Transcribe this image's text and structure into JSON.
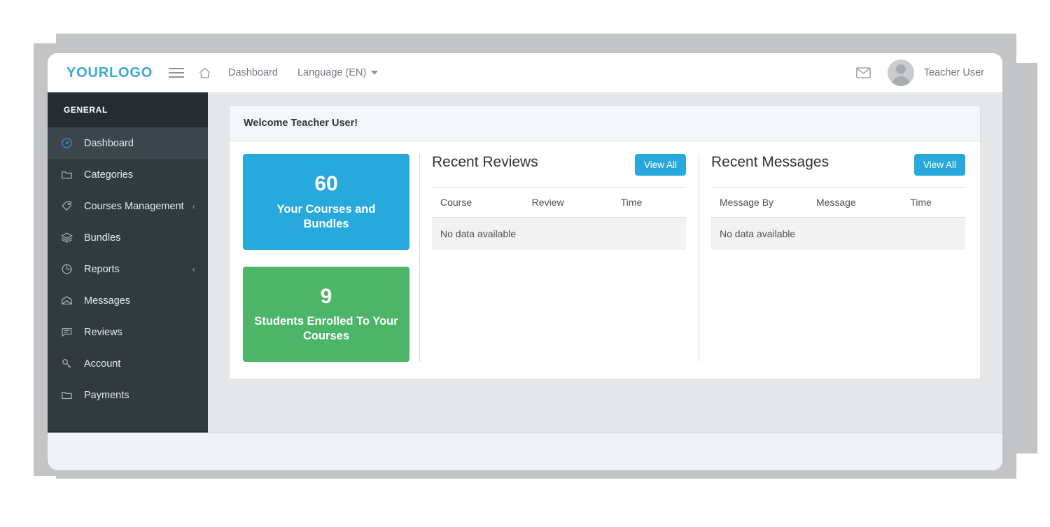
{
  "navbar": {
    "brand": "YOURLOGO",
    "menu_icon": "hamburger-icon",
    "home_icon": "home-icon",
    "dashboard_link": "Dashboard",
    "language_link": "Language (EN)",
    "mail_icon": "envelope-icon",
    "avatar_icon": "user-avatar",
    "user_name": "Teacher User"
  },
  "sidebar": {
    "heading": "GENERAL",
    "collapse_icon": "chevron-left-icon",
    "items": [
      {
        "label": "Dashboard",
        "icon": "speedometer-icon",
        "active": true,
        "arrow": ""
      },
      {
        "label": "Categories",
        "icon": "folder-icon",
        "active": false,
        "arrow": ""
      },
      {
        "label": "Courses Management",
        "icon": "tag-icon",
        "active": false,
        "arrow": "‹"
      },
      {
        "label": "Bundles",
        "icon": "layers-icon",
        "active": false,
        "arrow": ""
      },
      {
        "label": "Reports",
        "icon": "pie-chart-icon",
        "active": false,
        "arrow": "‹"
      },
      {
        "label": "Messages",
        "icon": "open-envelope-icon",
        "active": false,
        "arrow": ""
      },
      {
        "label": "Reviews",
        "icon": "comment-icon",
        "active": false,
        "arrow": ""
      },
      {
        "label": "Account",
        "icon": "key-icon",
        "active": false,
        "arrow": ""
      },
      {
        "label": "Payments",
        "icon": "wallet-icon",
        "active": false,
        "arrow": ""
      }
    ]
  },
  "main": {
    "welcome": "Welcome Teacher User!",
    "stats": [
      {
        "value": "60",
        "label": "Your Courses and Bundles",
        "color": "#28a9dd"
      },
      {
        "value": "9",
        "label": "Students Enrolled To Your Courses",
        "color": "#4cb568"
      }
    ],
    "reviews": {
      "title": "Recent Reviews",
      "view_all": "View All",
      "columns": [
        "Course",
        "Review",
        "Time"
      ],
      "empty_text": "No data available"
    },
    "messages": {
      "title": "Recent Messages",
      "view_all": "View All",
      "columns": [
        "Message By",
        "Message",
        "Time"
      ],
      "empty_text": "No data available"
    }
  },
  "colors": {
    "accent_blue": "#28a9dd",
    "accent_green": "#4cb568",
    "sidebar_bg": "#313a3f",
    "sidebar_heading_bg": "#262d31",
    "sidebar_active_bg": "#3b454b",
    "content_bg": "#e4e6e8"
  }
}
